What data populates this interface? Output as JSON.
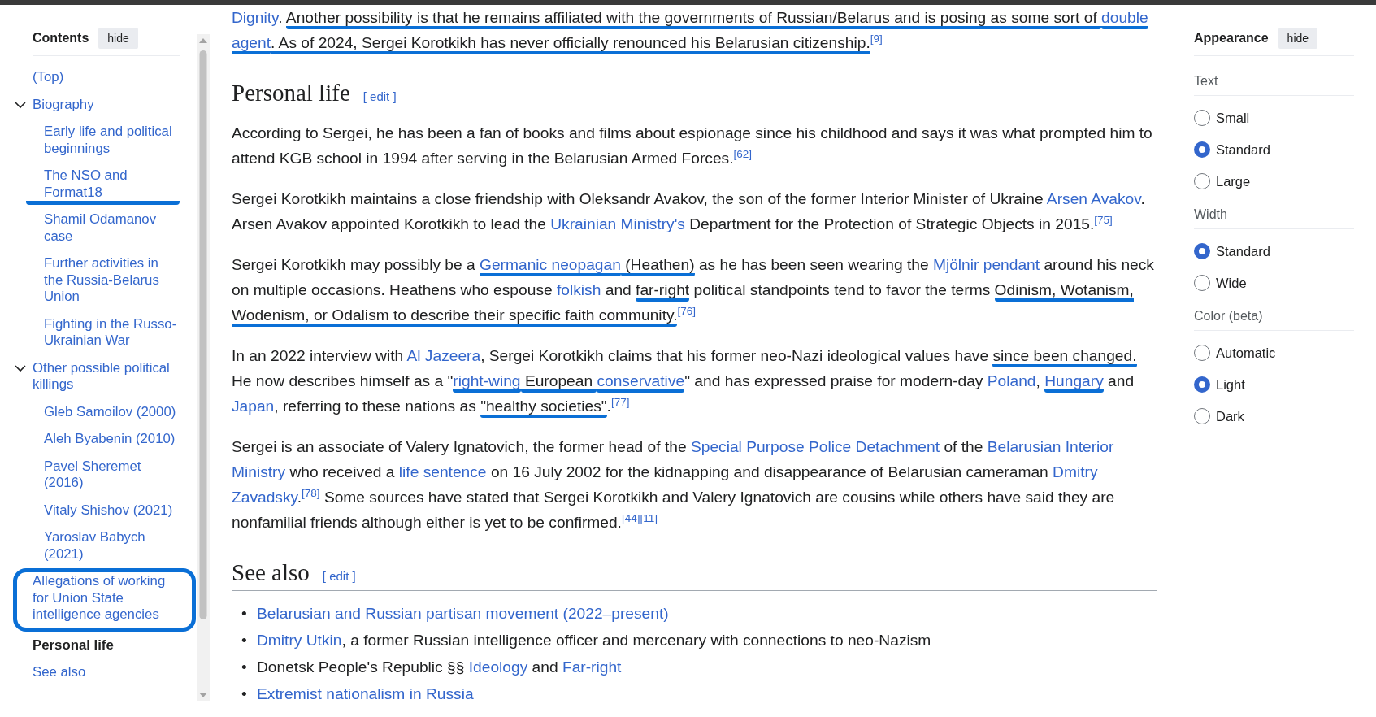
{
  "toc": {
    "title": "Contents",
    "hide_label": "hide",
    "items": [
      {
        "label": "(Top)",
        "selected": false
      },
      {
        "label": "Biography",
        "selected": false,
        "expanded": true,
        "children": [
          {
            "label": "Early life and political beginnings",
            "selected": false
          },
          {
            "label": "The NSO and Format18",
            "selected": false,
            "underlined": true
          },
          {
            "label": "Shamil Odamanov case",
            "selected": false
          },
          {
            "label": "Further activities in the Russia-Belarus Union",
            "selected": false
          },
          {
            "label": "Fighting in the Russo-Ukrainian War",
            "selected": false
          }
        ]
      },
      {
        "label": "Other possible political killings",
        "selected": false,
        "expanded": true,
        "children": [
          {
            "label": "Gleb Samoilov (2000)",
            "selected": false
          },
          {
            "label": "Aleh Byabenin (2010)",
            "selected": false
          },
          {
            "label": "Pavel Sheremet (2016)",
            "selected": false
          },
          {
            "label": "Vitaly Shishov (2021)",
            "selected": false
          },
          {
            "label": "Yaroslav Babych (2021)",
            "selected": false
          }
        ]
      },
      {
        "label": "Allegations of working for Union State intelligence agencies",
        "selected": false,
        "circled": true
      },
      {
        "label": "Personal life",
        "selected": true
      },
      {
        "label": "See also",
        "selected": false
      }
    ]
  },
  "intro_paragraph": [
    {
      "kind": "link",
      "text": "Dignity"
    },
    {
      "kind": "text",
      "text": ". "
    },
    {
      "kind": "marked_text",
      "text": "Another possibility is that he remains affiliated with the governments of Russian/Belarus and is posing as some sort of "
    },
    {
      "kind": "marked_link",
      "text": "double "
    },
    {
      "kind": "marked_link",
      "text": "agent"
    },
    {
      "kind": "marked_text",
      "text": ". As of 2024, Sergei Korotkikh has never officially renounced his Belarusian citizenship."
    },
    {
      "kind": "ref",
      "text": "[9]"
    }
  ],
  "sections": [
    {
      "heading": "Personal life",
      "edit_label": "[ edit ]",
      "paragraphs": [
        [
          {
            "kind": "text",
            "text": "According to Sergei, he has been a fan of books and films about espionage since his childhood and says it was what prompted him to attend KGB school in 1994 after serving in the Belarusian Armed Forces."
          },
          {
            "kind": "ref",
            "text": "[62]"
          }
        ],
        [
          {
            "kind": "text",
            "text": "Sergei Korotkikh maintains a close friendship with Oleksandr Avakov, the son of the former Interior Minister of Ukraine "
          },
          {
            "kind": "link",
            "text": "Arsen Avakov"
          },
          {
            "kind": "text",
            "text": ". Arsen Avakov appointed Korotkikh to lead the "
          },
          {
            "kind": "link",
            "text": "Ukrainian Ministry's"
          },
          {
            "kind": "text",
            "text": " Department for the Protection of Strategic Objects in 2015."
          },
          {
            "kind": "ref",
            "text": "[75]"
          }
        ],
        [
          {
            "kind": "text",
            "text": "Sergei Korotkikh may possibly be a "
          },
          {
            "kind": "marked_link",
            "text": "Germanic neopagan"
          },
          {
            "kind": "marked_text",
            "text": " (Heathen)"
          },
          {
            "kind": "text",
            "text": " as he has been seen wearing the "
          },
          {
            "kind": "link",
            "text": "Mjölnir pendant"
          },
          {
            "kind": "text",
            "text": " around his neck on multiple occasions. Heathens who espouse "
          },
          {
            "kind": "link",
            "text": "folkish"
          },
          {
            "kind": "text",
            "text": " and "
          },
          {
            "kind": "marked_text",
            "text": "far-right"
          },
          {
            "kind": "text",
            "text": " political standpoints tend to favor the terms "
          },
          {
            "kind": "marked_text",
            "text": "Odinism, Wotanism, Wodenism, or Odalism to describe their specific faith community."
          },
          {
            "kind": "ref",
            "text": "[76]"
          }
        ],
        [
          {
            "kind": "text",
            "text": "In an 2022 interview with "
          },
          {
            "kind": "link",
            "text": "Al Jazeera"
          },
          {
            "kind": "text",
            "text": ", Sergei Korotkikh claims that his former neo-Nazi ideological values have "
          },
          {
            "kind": "marked_text",
            "text": "since been changed."
          },
          {
            "kind": "text",
            "text": " He now describes himself as a \""
          },
          {
            "kind": "marked_link",
            "text": "right-wing"
          },
          {
            "kind": "marked_text",
            "text": " European "
          },
          {
            "kind": "marked_link",
            "text": "conservative"
          },
          {
            "kind": "text",
            "text": "\" and has expressed praise for modern-day "
          },
          {
            "kind": "link",
            "text": "Poland"
          },
          {
            "kind": "text",
            "text": ", "
          },
          {
            "kind": "marked_link",
            "text": "Hungary"
          },
          {
            "kind": "text",
            "text": " and "
          },
          {
            "kind": "link",
            "text": "Japan"
          },
          {
            "kind": "text",
            "text": ", referring to these nations as "
          },
          {
            "kind": "marked_text",
            "text": "\"healthy societies\""
          },
          {
            "kind": "text",
            "text": "."
          },
          {
            "kind": "ref",
            "text": "[77]"
          }
        ],
        [
          {
            "kind": "text",
            "text": "Sergei is an associate of Valery Ignatovich, the former head of the "
          },
          {
            "kind": "link",
            "text": "Special Purpose Police Detachment"
          },
          {
            "kind": "text",
            "text": " of the "
          },
          {
            "kind": "link",
            "text": "Belarusian Interior "
          },
          {
            "kind": "link",
            "text": "Ministry"
          },
          {
            "kind": "text",
            "text": " who received a "
          },
          {
            "kind": "link",
            "text": "life sentence"
          },
          {
            "kind": "text",
            "text": " on 16 July 2002 for the kidnapping and disappearance of Belarusian cameraman "
          },
          {
            "kind": "link",
            "text": "Dmitry "
          },
          {
            "kind": "link",
            "text": "Zavadsky"
          },
          {
            "kind": "text",
            "text": "."
          },
          {
            "kind": "ref",
            "text": "[78]"
          },
          {
            "kind": "text",
            "text": " Some sources have stated that Sergei Korotkikh and Valery Ignatovich are cousins while others have said they are nonfamilial friends although either is yet to be confirmed."
          },
          {
            "kind": "ref",
            "text": "[44]"
          },
          {
            "kind": "ref",
            "text": "[11]"
          }
        ]
      ]
    },
    {
      "heading": "See also",
      "edit_label": "[ edit ]",
      "list": [
        {
          "marker": "•",
          "segments": [
            {
              "kind": "link",
              "text": "Belarusian and Russian partisan movement (2022–present)"
            }
          ]
        },
        {
          "marker": "•",
          "segments": [
            {
              "kind": "link",
              "text": "Dmitry Utkin"
            },
            {
              "kind": "text",
              "text": ", a former Russian intelligence officer and mercenary with connections to neo-Nazism"
            }
          ]
        },
        {
          "marker": "•",
          "segments": [
            {
              "kind": "text",
              "text": "Donetsk People's Republic §§ "
            },
            {
              "kind": "link",
              "text": "Ideology"
            },
            {
              "kind": "text",
              "text": " and "
            },
            {
              "kind": "link",
              "text": "Far-right"
            }
          ]
        },
        {
          "marker": "•",
          "segments": [
            {
              "kind": "link",
              "text": "Extremist nationalism in Russia"
            }
          ]
        }
      ]
    }
  ],
  "appearance": {
    "title": "Appearance",
    "hide_label": "hide",
    "groups": [
      {
        "label": "Text",
        "options": [
          {
            "label": "Small",
            "selected": false
          },
          {
            "label": "Standard",
            "selected": true
          },
          {
            "label": "Large",
            "selected": false
          }
        ]
      },
      {
        "label": "Width",
        "options": [
          {
            "label": "Standard",
            "selected": true
          },
          {
            "label": "Wide",
            "selected": false
          }
        ]
      },
      {
        "label": "Color (beta)",
        "options": [
          {
            "label": "Automatic",
            "selected": false
          },
          {
            "label": "Light",
            "selected": true
          },
          {
            "label": "Dark",
            "selected": false
          }
        ]
      }
    ]
  }
}
